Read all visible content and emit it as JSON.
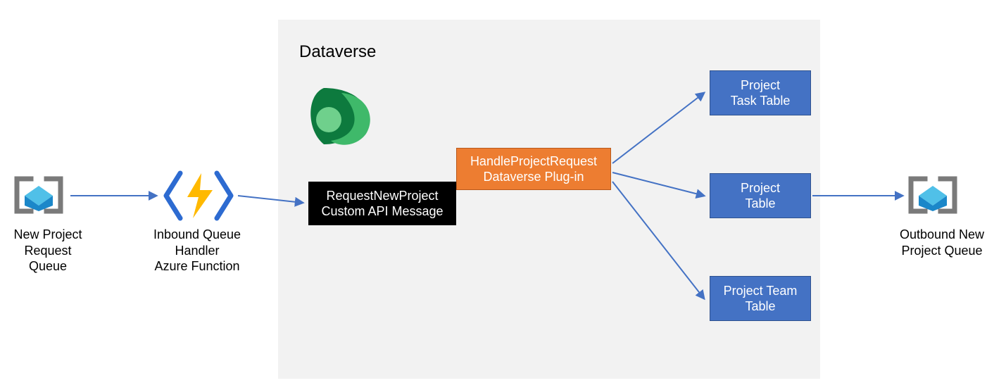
{
  "nodes": {
    "new_project_queue": {
      "label": "New Project\nRequest Queue"
    },
    "inbound_handler": {
      "label": "Inbound Queue Handler\nAzure Function"
    },
    "request_api": {
      "label": "RequestNewProject\nCustom API Message"
    },
    "handle_plugin": {
      "label": "HandleProjectRequest\nDataverse Plug-in"
    },
    "task_table": {
      "label": "Project\nTask Table"
    },
    "project_table": {
      "label": "Project\nTable"
    },
    "team_table": {
      "label": "Project Team\nTable"
    },
    "outbound_queue": {
      "label": "Outbound New\nProject Queue"
    }
  },
  "panel": {
    "title": "Dataverse"
  },
  "colors": {
    "arrow": "#4472c4",
    "panel_bg": "#f2f2f2",
    "orange": "#ed7d31",
    "blue": "#4472c4"
  }
}
